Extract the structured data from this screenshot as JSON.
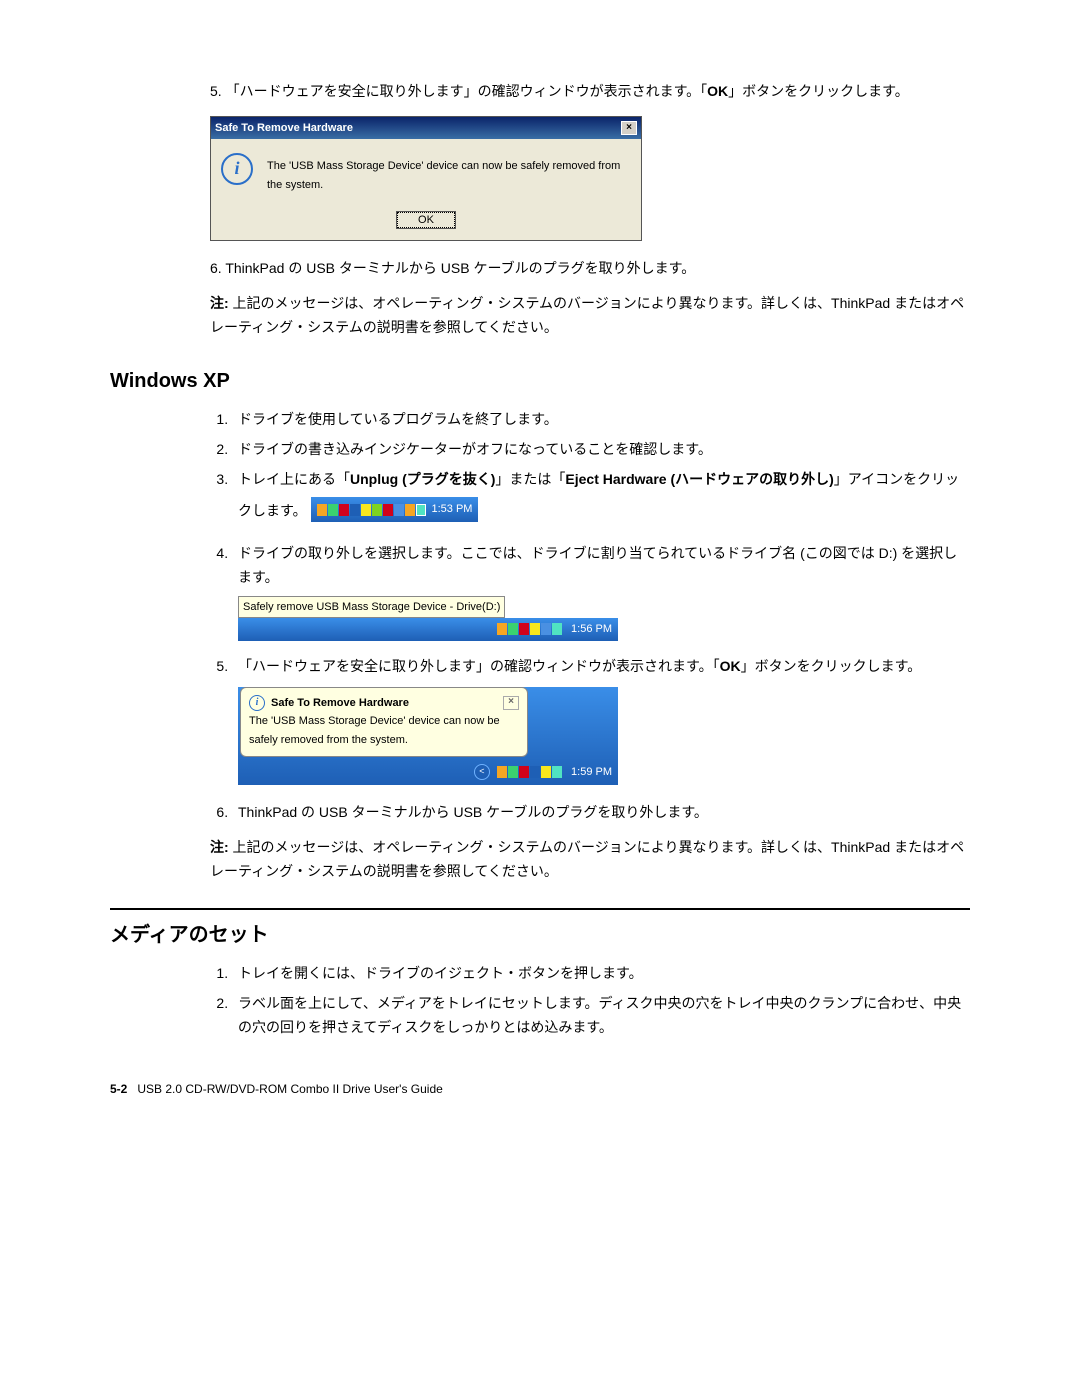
{
  "top_section": {
    "item5_pre": "5. 「ハードウェアを安全に取り外します」の確認ウィンドウが表示されます。「",
    "item5_bold": "OK",
    "item5_post": "」ボタンをクリックします。",
    "item6": "6. ThinkPad の USB ターミナルから USB ケーブルのプラグを取り外します。",
    "note_label": "注:",
    "note_text": " 上記のメッセージは、オペレーティング・システムのバージョンにより異なります。詳しくは、ThinkPad またはオペレーティング・システムの説明書を参照してください。"
  },
  "win2k_dialog": {
    "title": "Safe To Remove Hardware",
    "message": "The 'USB Mass Storage Device' device can now be safely removed from the system.",
    "ok": "OK",
    "close": "×"
  },
  "xp_heading": "Windows XP",
  "xp_list": {
    "i1": "ドライブを使用しているプログラムを終了します。",
    "i2": "ドライブの書き込みインジケーターがオフになっていることを確認します。",
    "i3_pre": "トレイ上にある「",
    "i3_b1": "Unplug (プラグを抜く)",
    "i3_mid": "」または「",
    "i3_b2": "Eject Hardware (ハードウェアの取り外し)",
    "i3_post": "」アイコンをクリックします。",
    "i4": "ドライブの取り外しを選択します。ここでは、ドライブに割り当てられているドライブ名 (この図では D:) を選択します。",
    "i5_pre": "「ハードウェアを安全に取り外します」の確認ウィンドウが表示されます。「",
    "i5_bold": "OK",
    "i5_post": "」ボタンをクリックします。",
    "i6": "ThinkPad の USB ターミナルから USB ケーブルのプラグを取り外します。"
  },
  "tray1_time": "1:53 PM",
  "tray2_tip": "Safely remove USB Mass Storage Device - Drive(D:)",
  "tray2_time": "1:56 PM",
  "xp_balloon": {
    "title": "Safe To Remove Hardware",
    "msg": "The 'USB Mass Storage Device' device can now be safely removed from the system.",
    "close": "×",
    "time": "1:59 PM"
  },
  "xp_note_label": "注:",
  "xp_note_text": " 上記のメッセージは、オペレーティング・システムのバージョンにより異なります。詳しくは、ThinkPad またはオペレーティング・システムの説明書を参照してください。",
  "media_heading": "メディアのセット",
  "media_list": {
    "i1": "トレイを開くには、ドライブのイジェクト・ボタンを押します。",
    "i2": "ラベル面を上にして、メディアをトレイにセットします。ディスク中央の穴をトレイ中央のクランプに合わせ、中央の穴の回りを押さえてディスクをしっかりとはめ込みます。"
  },
  "footer": {
    "page": "5-2",
    "title": "USB 2.0 CD-RW/DVD-ROM Combo II Drive User's Guide"
  }
}
